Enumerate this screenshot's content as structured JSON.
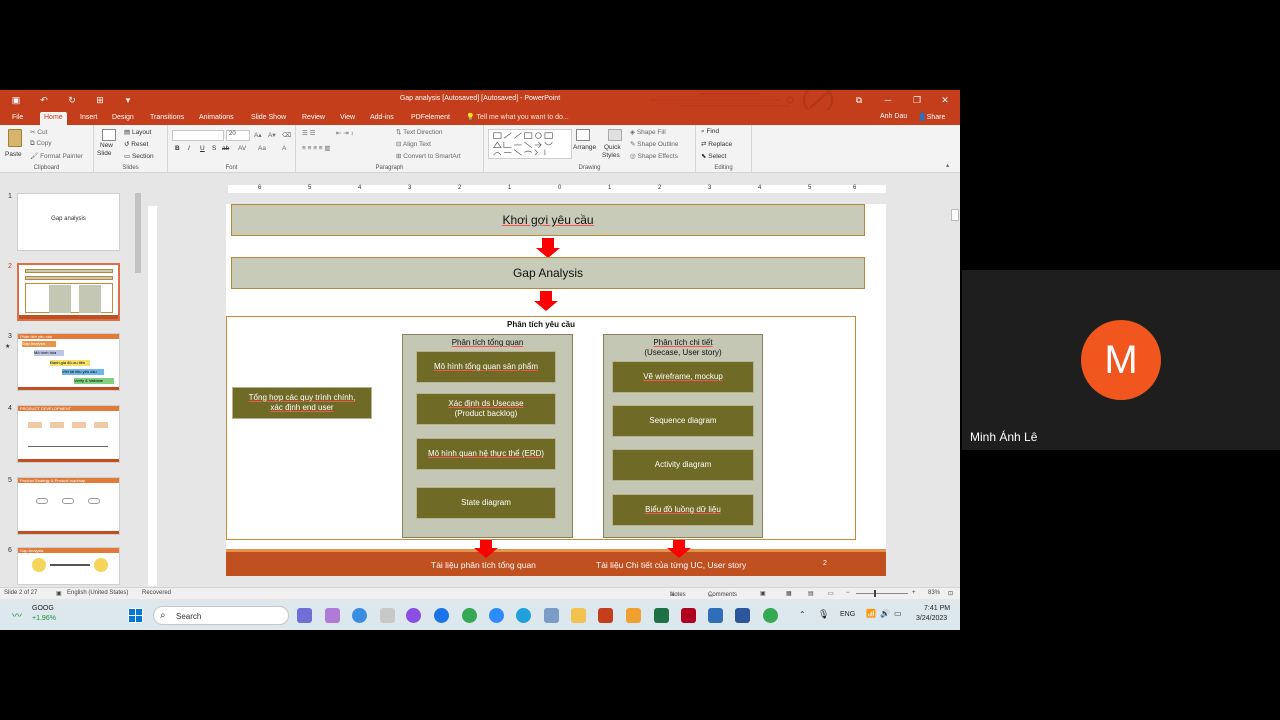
{
  "window": {
    "title": "Gap analysis [Autosaved] [Autosaved] - PowerPoint"
  },
  "tabs": [
    "File",
    "Home",
    "Insert",
    "Design",
    "Transitions",
    "Animations",
    "Slide Show",
    "Review",
    "View",
    "Add-ins",
    "PDFelement"
  ],
  "active_tab": "Home",
  "tell_me": "Tell me what you want to do...",
  "user": "Anh Dau",
  "share_label": "Share",
  "ribbon": {
    "clipboard": {
      "paste": "Paste",
      "cut": "Cut",
      "copy": "Copy",
      "format_painter": "Format Painter",
      "label": "Clipboard"
    },
    "slides": {
      "new_slide_1": "New",
      "new_slide_2": "Slide",
      "layout": "Layout",
      "reset": "Reset",
      "section": "Section",
      "label": "Slides"
    },
    "font": {
      "size": "20",
      "label": "Font",
      "bold": "B",
      "italic": "I",
      "underline": "U",
      "strike": "S",
      "shadow": "ab",
      "spacing": "AV",
      "case": "Aa",
      "color": "A"
    },
    "paragraph": {
      "text_direction": "Text Direction",
      "align_text": "Align Text",
      "smartart": "Convert to SmartArt",
      "label": "Paragraph"
    },
    "drawing": {
      "arrange": "Arrange",
      "quick_styles_1": "Quick",
      "quick_styles_2": "Styles",
      "shape_fill": "Shape Fill",
      "shape_outline": "Shape Outline",
      "shape_effects": "Shape Effects",
      "label": "Drawing"
    },
    "editing": {
      "find": "Find",
      "replace": "Replace",
      "select": "Select",
      "label": "Editing"
    }
  },
  "ruler": [
    "6",
    "5",
    "4",
    "3",
    "2",
    "1",
    "0",
    "1",
    "2",
    "3",
    "4",
    "5",
    "6"
  ],
  "thumbnails": [
    {
      "num": "1",
      "text": "Gap analysis"
    },
    {
      "num": "2",
      "text": ""
    },
    {
      "num": "3",
      "text": "Phân tích yêu cầu"
    },
    {
      "num": "4",
      "text": "PRODUCT DEVELOPMENT"
    },
    {
      "num": "5",
      "text": "Product Strategy & Product roadmap"
    },
    {
      "num": "6",
      "text": "Gap Analysis"
    }
  ],
  "thumb3_items": [
    "Gap Analysis",
    "Mô hình hóa",
    "Đánh giá độ ưu tiên",
    "Viết tài liệu yêu cầu",
    "Verify & Validate"
  ],
  "slide": {
    "top_bar": "Khơi gợi yêu cầu",
    "mid_bar": "Gap Analysis",
    "section_title": "Phân tích yêu cầu",
    "left_box_1": "Tổng hợp các quy trình chính,",
    "left_box_2": "xác định end user",
    "col1_title": "Phân tích tổng quan",
    "col1_items": [
      "Mô hình tổng quan sản phẩm",
      "Xác định ds Usecase",
      "(Product backlog)",
      "Mô hình quan hệ thực thể (ERD)",
      "State diagram"
    ],
    "col2_title_1": "Phân tích chi tiết",
    "col2_title_2": "(Usecase, User story)",
    "col2_items": [
      "Vẽ wireframe, mockup",
      "Sequence diagram",
      "Activity diagram",
      "Biểu đồ luồng dữ liệu"
    ],
    "footer_left": "Tài liệu phân tích tổng quan",
    "footer_right": "Tài liệu Chi tiết của từng UC, User story",
    "page_number": "2"
  },
  "status": {
    "slide": "Slide 2 of 27",
    "language": "English (United States)",
    "recovered": "Recovered",
    "notes": "Notes",
    "comments": "Comments",
    "zoom": "83%"
  },
  "taskbar": {
    "stock_name": "GOOG",
    "stock_change": "+1.96%",
    "search": "Search",
    "lang": "ENG",
    "time": "7:41 PM",
    "date": "3/24/2023"
  },
  "participant": {
    "initial": "M",
    "name": "Minh Ánh Lê"
  },
  "colors": {
    "accent": "#c43e1c",
    "box": "#6f6a25",
    "column": "#c3c7b4",
    "avatar": "#f0561d"
  }
}
